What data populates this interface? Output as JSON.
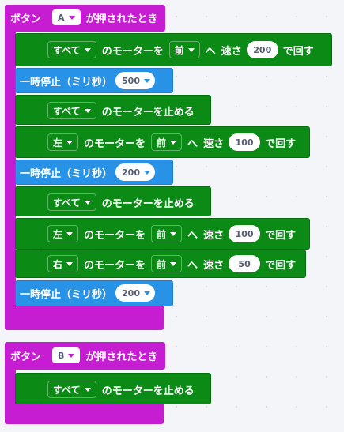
{
  "hat_a": {
    "prefix": "ボタン",
    "button": "A",
    "suffix": "が押されたとき"
  },
  "hat_b": {
    "prefix": "ボタン",
    "button": "B",
    "suffix": "が押されたとき"
  },
  "motor_run_1": {
    "target": "すべて",
    "text1": "のモーターを",
    "dir": "前",
    "text2": "へ",
    "text3": "速さ",
    "speed": "200",
    "text4": "で回す"
  },
  "pause_1": {
    "label": "一時停止（ミリ秒）",
    "value": "500"
  },
  "motor_stop_1": {
    "target": "すべて",
    "text": "のモーターを止める"
  },
  "motor_run_2": {
    "target": "左",
    "text1": "のモーターを",
    "dir": "前",
    "text2": "へ",
    "text3": "速さ",
    "speed": "100",
    "text4": "で回す"
  },
  "pause_2": {
    "label": "一時停止（ミリ秒）",
    "value": "200"
  },
  "motor_stop_2": {
    "target": "すべて",
    "text": "のモーターを止める"
  },
  "motor_run_3": {
    "target": "左",
    "text1": "のモーターを",
    "dir": "前",
    "text2": "へ",
    "text3": "速さ",
    "speed": "100",
    "text4": "で回す"
  },
  "motor_run_4": {
    "target": "右",
    "text1": "のモーターを",
    "dir": "前",
    "text2": "へ",
    "text3": "速さ",
    "speed": "50",
    "text4": "で回す"
  },
  "pause_3": {
    "label": "一時停止（ミリ秒）",
    "value": "200"
  },
  "motor_stop_3": {
    "target": "すべて",
    "text": "のモーターを止める"
  },
  "colors": {
    "event": "#c61dd3",
    "motor": "#0b8a16",
    "basic": "#2792e6",
    "workspace": "#f3f5f8"
  }
}
